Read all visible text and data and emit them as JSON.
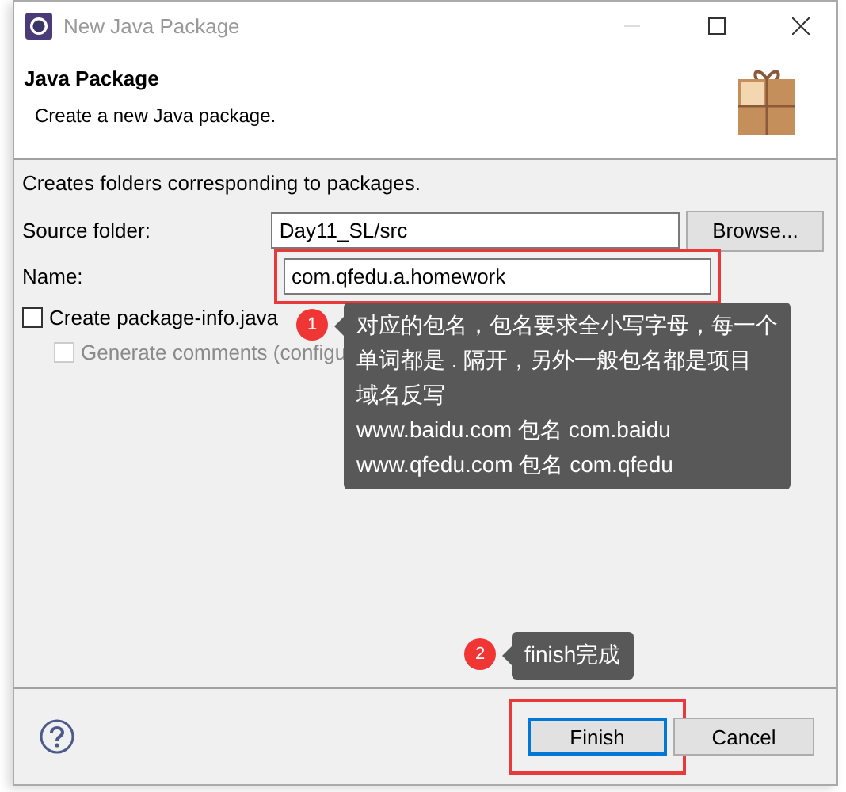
{
  "window": {
    "title": "New Java Package"
  },
  "header": {
    "title": "Java Package",
    "subtitle": "Create a new Java package."
  },
  "description": "Creates folders corresponding to packages.",
  "fields": [
    {
      "label": "Source folder:",
      "value": "Day11_SL/src",
      "button": "Browse...",
      "highlighted": false
    },
    {
      "label": "Name:",
      "value": "com.qfedu.a.homework",
      "highlighted": true
    }
  ],
  "checkboxes": [
    {
      "label": "Create package-info.java",
      "checked": false,
      "disabled": false
    },
    {
      "label": "Generate comments (configu",
      "checked": false,
      "disabled": true
    }
  ],
  "annotations": [
    {
      "number": "1",
      "lines": [
        "对应的包名，包名要求全小写字母，每一个",
        "单词都是 . 隔开，另外一般包名都是项目",
        "域名反写",
        "www.baidu.com 包名 com.baidu",
        "www.qfedu.com 包名 com.qfedu"
      ]
    },
    {
      "number": "2",
      "lines": [
        "finish完成"
      ]
    }
  ],
  "buttons": [
    {
      "label": "Finish",
      "default": true,
      "highlighted": true
    },
    {
      "label": "Cancel",
      "default": false,
      "highlighted": false
    }
  ]
}
